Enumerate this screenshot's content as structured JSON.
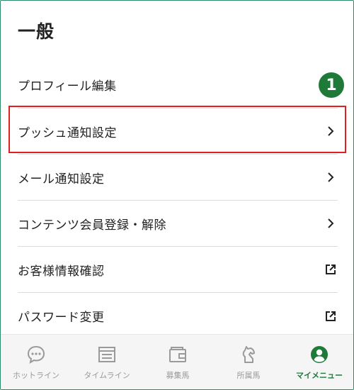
{
  "section": {
    "title": "一般"
  },
  "step_badge": "1",
  "menu": {
    "items": [
      {
        "label": "プロフィール編集",
        "trailing": "none"
      },
      {
        "label": "プッシュ通知設定",
        "trailing": "chevron-right-icon"
      },
      {
        "label": "メール通知設定",
        "trailing": "chevron-right-icon"
      },
      {
        "label": "コンテンツ会員登録・解除",
        "trailing": "chevron-right-icon"
      },
      {
        "label": "お客様情報確認",
        "trailing": "external-link-icon"
      },
      {
        "label": "パスワード変更",
        "trailing": "external-link-icon"
      }
    ]
  },
  "tabbar": {
    "items": [
      {
        "label": "ホットライン",
        "icon": "chat-bubble-icon",
        "active": false
      },
      {
        "label": "タイムライン",
        "icon": "timeline-icon",
        "active": false
      },
      {
        "label": "募集馬",
        "icon": "wallet-icon",
        "active": false
      },
      {
        "label": "所属馬",
        "icon": "horse-icon",
        "active": false
      },
      {
        "label": "マイメニュー",
        "icon": "user-icon",
        "active": true
      }
    ]
  },
  "colors": {
    "accent": "#1f7a3a",
    "highlight": "#e02020",
    "inactive": "#9a9a9a",
    "frame": "#2e8b6a"
  }
}
